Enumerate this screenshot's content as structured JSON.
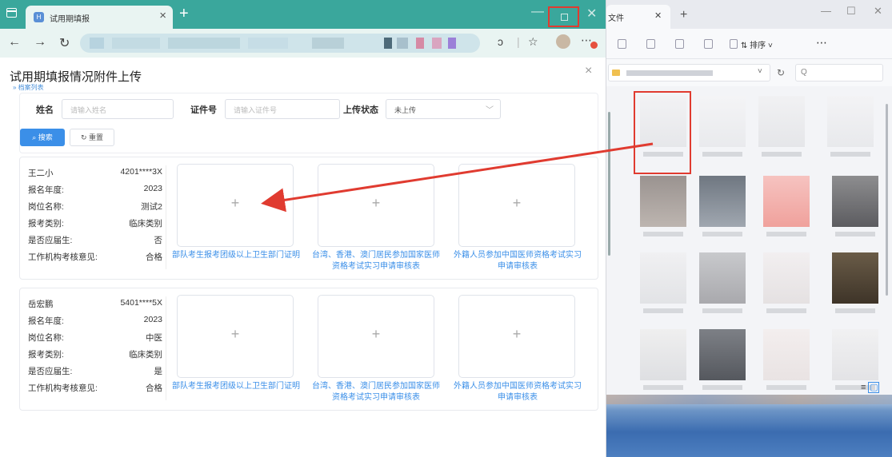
{
  "browser": {
    "tab_title": "试用期填报",
    "new_tab_icon": "plus-icon",
    "accent_color": "#3aa79c"
  },
  "modal": {
    "title": "试用期填报情况附件上传",
    "breadcrumb": "» 档案列表",
    "filter": {
      "name_label": "姓名",
      "name_placeholder": "请输入姓名",
      "id_label": "证件号",
      "id_placeholder": "请输入证件号",
      "status_label": "上传状态",
      "status_value": "未上传",
      "search_button": "搜索",
      "reset_button": "重置"
    },
    "field_labels": {
      "year": "报名年度:",
      "position": "岗位名称:",
      "category": "报考类别:",
      "fresh_grad": "是否应届生:",
      "review": "工作机构考核意见:"
    },
    "upload_labels": {
      "military": "部队考生报考团级以上卫生部门证明",
      "hk_macau_tw_line1": "台湾、香港、澳门居民参加国家医师",
      "hk_macau_tw_line2": "资格考试实习申请审核表",
      "foreign_line1": "外籍人员参加中国医师资格考试实习",
      "foreign_line2": "申请审核表"
    },
    "records": [
      {
        "name": "王二小",
        "id": "4201****3X",
        "year": "2023",
        "position": "测试2",
        "category": "临床类别",
        "fresh_grad": "否",
        "review": "合格"
      },
      {
        "name": "岳宏鹏",
        "id": "5401****5X",
        "year": "2023",
        "position": "中医",
        "category": "临床类别",
        "fresh_grad": "是",
        "review": "合格"
      }
    ]
  },
  "explorer": {
    "tab_title": "文件",
    "sort_label": "排序",
    "search_placeholder": "Q"
  },
  "colors": {
    "highlight_red": "#e03b30",
    "link_blue": "#3b8fe8"
  }
}
